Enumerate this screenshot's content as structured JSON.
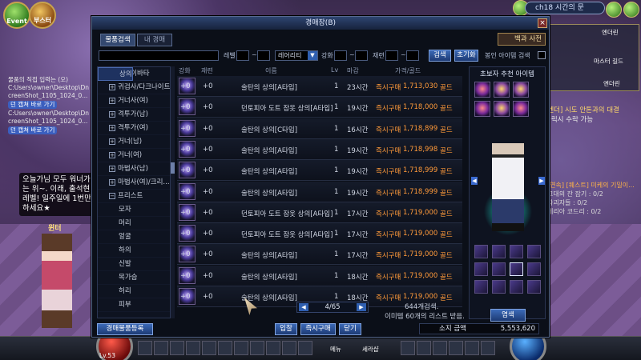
{
  "hud": {
    "event_label": "Event",
    "booster_label": "부스터",
    "channel": "ch18 시간의 문",
    "minimap_labels": [
      "마스터 길드",
      "엔더린"
    ],
    "town_label": "엔더린"
  },
  "chat": {
    "lines": [
      "물품의 직접 입력는 (오)",
      "C:Users\\owner\\Desktop\\Dn",
      "creenShot_1105_1024_0...",
      "C:Users\\owner\\Desktop\\Dn",
      "creenShot_1105_1024_0..."
    ],
    "link1": "던 캡쳐 바로 가기",
    "link2": "던 캡쳐 바로 가기"
  },
  "speech": "오늘가님 모두 워너가는 위~. 이래, 출석현 레벨! 일주일에 1번만 하세요★",
  "npc_name": "윈터",
  "quest": {
    "title": "[엔더] 시도 안톤과의 대결",
    "sub": "클릭시 수락 가능",
    "title2": "[연속] [퀘스트] 미케의 기밀이...",
    "sub2a": "고대의 잔 잡기 : 0/2",
    "sub2b": "파괴자들 : 0/2",
    "sub2c": "케리아 코드리 : 0/2"
  },
  "auction": {
    "window_title": "경매장(B)",
    "tabs": [
      "물품검색",
      "내 경매"
    ],
    "scope_button": "백과 사전",
    "search": {
      "level_label": "레벨",
      "rarity_value": "레어리티",
      "enhance_label": "강화",
      "grade_label": "재련",
      "search_button": "검색",
      "reset_button": "초기화",
      "my_item_search": "봉인 아이템 검색"
    },
    "tree": [
      {
        "label": "엘봉컴 이바타",
        "indent": 0,
        "pm": "−"
      },
      {
        "label": "귀검사/다크나이트",
        "indent": 1,
        "pm": "+"
      },
      {
        "label": "거너사(여)",
        "indent": 1,
        "pm": "+"
      },
      {
        "label": "격투가(남)",
        "indent": 1,
        "pm": "+"
      },
      {
        "label": "격투가(여)",
        "indent": 1,
        "pm": "+"
      },
      {
        "label": "거너(남)",
        "indent": 1,
        "pm": "+"
      },
      {
        "label": "거너(여)",
        "indent": 1,
        "pm": "+"
      },
      {
        "label": "마법사(남)",
        "indent": 1,
        "pm": "+"
      },
      {
        "label": "마법사(여)/크리...",
        "indent": 1,
        "pm": "+"
      },
      {
        "label": "프리스트",
        "indent": 1,
        "pm": "−"
      },
      {
        "label": "모자",
        "indent": 2,
        "pm": ""
      },
      {
        "label": "머리",
        "indent": 2,
        "pm": ""
      },
      {
        "label": "얼굴",
        "indent": 2,
        "pm": ""
      },
      {
        "label": "상의",
        "indent": 2,
        "pm": "",
        "selected": true
      },
      {
        "label": "하의",
        "indent": 2,
        "pm": ""
      },
      {
        "label": "신발",
        "indent": 2,
        "pm": ""
      },
      {
        "label": "목가슴",
        "indent": 2,
        "pm": ""
      },
      {
        "label": "허리",
        "indent": 2,
        "pm": ""
      },
      {
        "label": "피부",
        "indent": 2,
        "pm": ""
      }
    ],
    "table_headers": {
      "enhance": "강화",
      "grade": "재련",
      "name": "이름",
      "level": "Lv",
      "time": "마감",
      "price": "가격/골드"
    },
    "rows": [
      {
        "enhance": "+0",
        "grade": "+0",
        "name": "술탄의 상의[A타입]",
        "level": "1",
        "time": "23시간",
        "buy": "즉시구매",
        "price": "1,713,030",
        "unit": "골드"
      },
      {
        "enhance": "+0",
        "grade": "+0",
        "name": "던토피아 도트 잠옷 상의[A타입]",
        "level": "1",
        "time": "19시간",
        "buy": "즉시구매",
        "price": "1,718,000",
        "unit": "골드"
      },
      {
        "enhance": "+0",
        "grade": "+0",
        "name": "술탄의 상의[C타입]",
        "level": "1",
        "time": "16시간",
        "buy": "즉시구매",
        "price": "1,718,899",
        "unit": "골드"
      },
      {
        "enhance": "+0",
        "grade": "+0",
        "name": "술탄의 상의[A타입]",
        "level": "1",
        "time": "19시간",
        "buy": "즉시구매",
        "price": "1,718,998",
        "unit": "골드"
      },
      {
        "enhance": "+0",
        "grade": "+0",
        "name": "술탄의 상의[A타입]",
        "level": "1",
        "time": "19시간",
        "buy": "즉시구매",
        "price": "1,718,999",
        "unit": "골드"
      },
      {
        "enhance": "+0",
        "grade": "+0",
        "name": "술탄의 상의[A타입]",
        "level": "1",
        "time": "19시간",
        "buy": "즉시구매",
        "price": "1,718,999",
        "unit": "골드"
      },
      {
        "enhance": "+0",
        "grade": "+0",
        "name": "던토피아 도트 잠옷 상의[A타입]",
        "level": "1",
        "time": "17시간",
        "buy": "즉시구매",
        "price": "1,719,000",
        "unit": "골드"
      },
      {
        "enhance": "+0",
        "grade": "+0",
        "name": "던토피아 도트 잠옷 상의[A타입]",
        "level": "1",
        "time": "17시간",
        "buy": "즉시구매",
        "price": "1,719,000",
        "unit": "골드"
      },
      {
        "enhance": "+0",
        "grade": "+0",
        "name": "술탄의 상의[A타입]",
        "level": "1",
        "time": "17시간",
        "buy": "즉시구매",
        "price": "1,719,000",
        "unit": "골드"
      },
      {
        "enhance": "+0",
        "grade": "+0",
        "name": "술탄의 상의[A타입]",
        "level": "1",
        "time": "18시간",
        "buy": "즉시구매",
        "price": "1,719,000",
        "unit": "골드"
      },
      {
        "enhance": "+0",
        "grade": "+0",
        "name": "술탄의 상의[A타입]",
        "level": "1",
        "time": "18시간",
        "buy": "즉시구매",
        "price": "1,719,000",
        "unit": "골드"
      }
    ],
    "pager": "4/65",
    "result_count": "644개검색.",
    "result_note": "이미템 60개의 리스트 받음.",
    "register_button": "경매물품등록",
    "bid_button": "입찰",
    "buy_now_button": "즉시구매",
    "close_button": "닫기",
    "money_label": "소지 금액",
    "money_value": "5,553,620",
    "rec_title": "초보자 추천 아이템",
    "equip_button": "염색"
  },
  "bottom": {
    "level": "Lv.53",
    "skill_labels": [
      "메뉴",
      "세라샵"
    ],
    "icons": [
      "hp-orb-icon",
      "mp-orb-icon"
    ]
  }
}
